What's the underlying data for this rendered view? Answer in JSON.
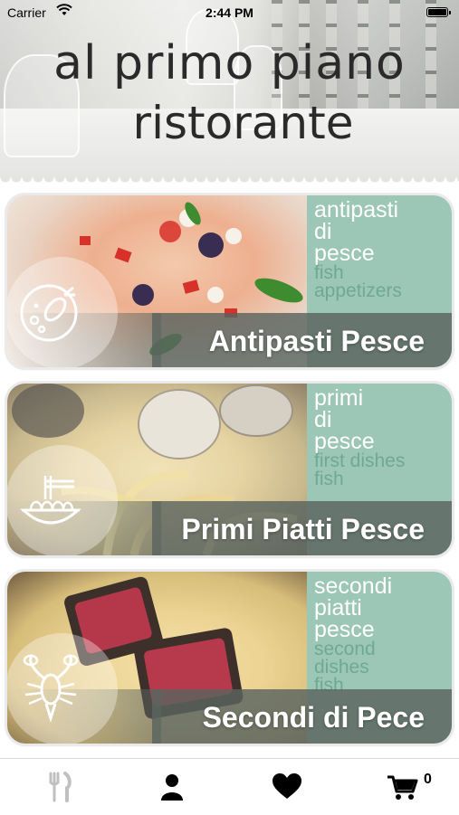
{
  "status_bar": {
    "carrier": "Carrier",
    "time": "2:44 PM",
    "icons": [
      "wifi-icon",
      "battery-icon"
    ]
  },
  "header": {
    "title_line1": "al primo piano",
    "title_line2": "ristorante"
  },
  "categories": [
    {
      "title": "Antipasti Pesce",
      "it_lines": [
        "antipasti",
        "di",
        "pesce"
      ],
      "en_lines": [
        "fish",
        "appetizers"
      ],
      "icon": "fish-plate-icon"
    },
    {
      "title": "Primi Piatti Pesce",
      "it_lines": [
        "primi",
        "di",
        "pesce"
      ],
      "en_lines": [
        "first dishes",
        "fish"
      ],
      "icon": "pasta-bowl-icon"
    },
    {
      "title": "Secondi di Pece",
      "it_lines": [
        "secondi",
        "piatti",
        "pesce"
      ],
      "en_lines": [
        "second",
        "dishes",
        "fish"
      ],
      "icon": "lobster-icon"
    }
  ],
  "tab_bar": {
    "tabs": [
      {
        "icon": "fork-knife-icon",
        "active": false
      },
      {
        "icon": "user-icon",
        "active": true
      },
      {
        "icon": "heart-icon",
        "active": true
      },
      {
        "icon": "cart-icon",
        "active": true
      }
    ],
    "cart_count": "0"
  },
  "colors": {
    "panel": "#9cc7b7",
    "panel_subtext": "#6fa893",
    "band": "#5a645f",
    "tab_inactive": "#c0c0c0",
    "tab_active": "#000000"
  }
}
